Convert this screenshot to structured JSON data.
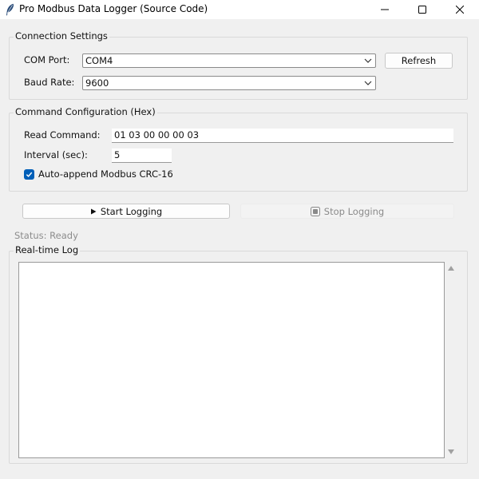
{
  "window": {
    "title": "Pro Modbus Data Logger (Source Code)"
  },
  "connection": {
    "group_label": "Connection Settings",
    "com_port_label": "COM Port:",
    "com_port_value": "COM4",
    "refresh_label": "Refresh",
    "baud_rate_label": "Baud Rate:",
    "baud_rate_value": "9600"
  },
  "command": {
    "group_label": "Command Configuration (Hex)",
    "read_command_label": "Read Command:",
    "read_command_value": "01 03 00 00 00 03",
    "interval_label": "Interval (sec):",
    "interval_value": "5",
    "crc_label": "Auto-append Modbus CRC-16",
    "crc_checked": true
  },
  "actions": {
    "start_label": "Start Logging",
    "stop_label": "Stop Logging"
  },
  "status": {
    "text": "Status: Ready"
  },
  "log": {
    "group_label": "Real-time Log"
  },
  "colors": {
    "accent": "#005fb8",
    "background": "#f0f0f0",
    "disabled_text": "#8a8a8a"
  },
  "icons": {
    "app": "feather-icon",
    "start": "play-icon",
    "stop": "stop-icon"
  }
}
